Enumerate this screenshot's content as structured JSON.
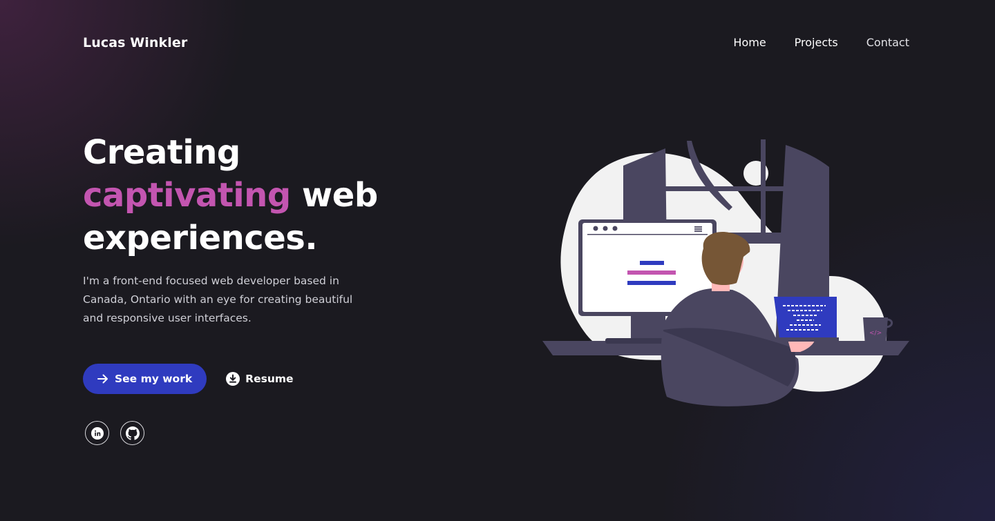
{
  "header": {
    "brand": "Lucas Winkler",
    "nav": [
      {
        "label": "Home"
      },
      {
        "label": "Projects"
      },
      {
        "label": "Contact"
      }
    ]
  },
  "hero": {
    "title_line1": "Creating",
    "title_accent": "captivating",
    "title_line2_rest": " web",
    "title_line3": "experiences.",
    "description": "I'm a front-end focused web developer based in Canada, Ontario with an eye for creating beautiful and responsive user interfaces.",
    "primary_button": {
      "label": "See my work",
      "icon": "arrow-right-icon"
    },
    "secondary_button": {
      "label": "Resume",
      "icon": "download-icon"
    },
    "socials": [
      {
        "name": "linkedin",
        "icon": "linkedin-icon"
      },
      {
        "name": "github",
        "icon": "github-icon"
      }
    ]
  },
  "colors": {
    "background": "#1b1a20",
    "accent": "#c355b0",
    "primary": "#2f3bbf",
    "illustration_dark": "#4a4660",
    "illustration_blob": "#f2f2f2"
  }
}
